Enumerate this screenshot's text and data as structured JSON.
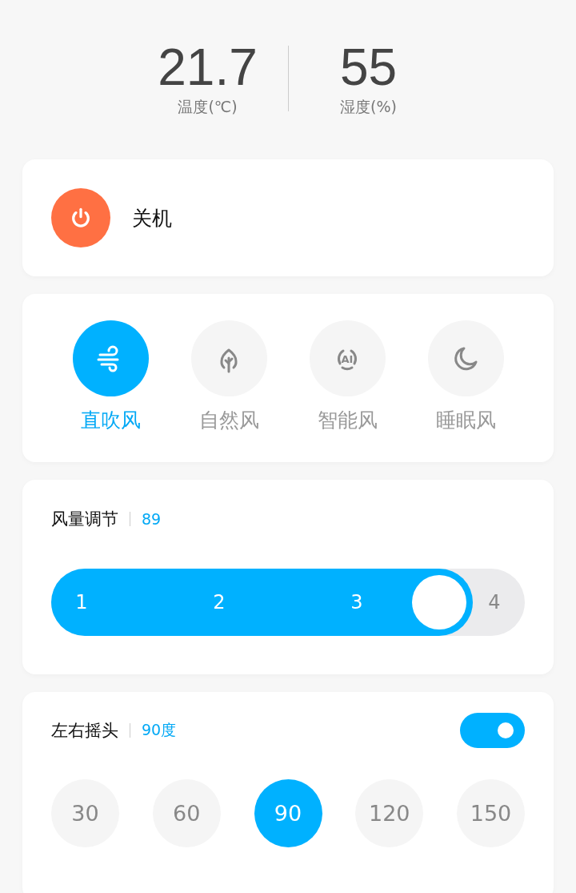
{
  "readings": [
    {
      "value": "21.7",
      "label": "温度(℃)"
    },
    {
      "value": "55",
      "label": "湿度(%)"
    }
  ],
  "power": {
    "label": "关机"
  },
  "modes": [
    {
      "kind": "wind",
      "label": "直吹风",
      "selected": true
    },
    {
      "kind": "leaf",
      "label": "自然风",
      "selected": false
    },
    {
      "kind": "ai",
      "icon_text": "AI",
      "label": "智能风",
      "selected": false
    },
    {
      "kind": "moon",
      "label": "睡眠风",
      "selected": false
    }
  ],
  "fan_speed": {
    "title": "风量调节",
    "value": "89",
    "level": 0.89,
    "ticks": [
      "1",
      "2",
      "3",
      "4"
    ]
  },
  "swing": {
    "title": "左右摇头",
    "value": "90度",
    "on": true,
    "angles": [
      {
        "label": "30",
        "selected": false
      },
      {
        "label": "60",
        "selected": false
      },
      {
        "label": "90",
        "selected": true
      },
      {
        "label": "120",
        "selected": false
      },
      {
        "label": "150",
        "selected": false
      }
    ]
  }
}
